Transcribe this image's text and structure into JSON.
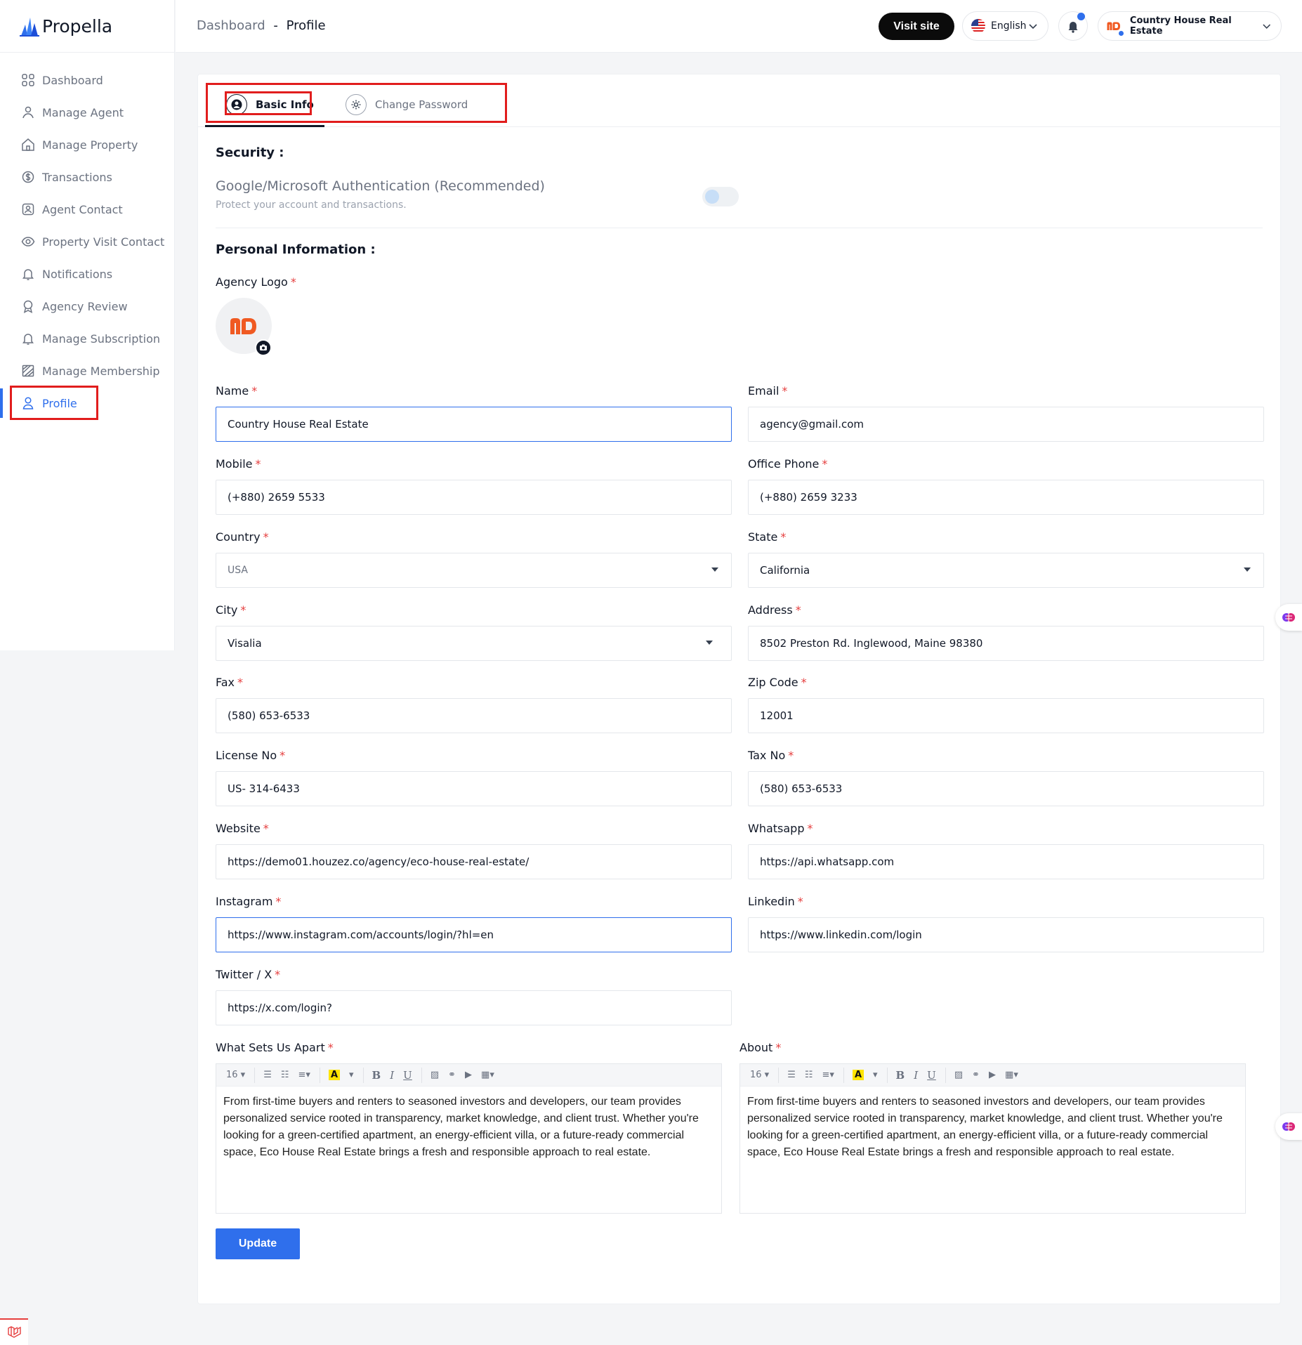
{
  "brand": {
    "name": "Propella"
  },
  "sidebar": {
    "items": [
      {
        "label": "Dashboard"
      },
      {
        "label": "Manage Agent"
      },
      {
        "label": "Manage Property"
      },
      {
        "label": "Transactions"
      },
      {
        "label": "Agent Contact"
      },
      {
        "label": "Property Visit Contact"
      },
      {
        "label": "Notifications"
      },
      {
        "label": "Agency Review"
      },
      {
        "label": "Manage Subscription"
      },
      {
        "label": "Manage Membership"
      },
      {
        "label": "Profile"
      }
    ],
    "active": "Profile"
  },
  "header": {
    "breadcrumb_root": "Dashboard",
    "breadcrumb_sep": "-",
    "breadcrumb_current": "Profile",
    "visit_site": "Visit site",
    "language": "English",
    "account_name": "Country House Real Estate"
  },
  "tabs": {
    "basic": "Basic Info",
    "password": "Change Password"
  },
  "security": {
    "title": "Security :",
    "auth_label": "Google/Microsoft Authentication (Recommended)",
    "auth_desc": "Protect your account and transactions.",
    "auth_enabled": false
  },
  "personal": {
    "title": "Personal Information :"
  },
  "form": {
    "logo_label": "Agency Logo",
    "name": {
      "label": "Name",
      "value": "Country House Real Estate"
    },
    "email": {
      "label": "Email",
      "value": "agency@gmail.com"
    },
    "mobile": {
      "label": "Mobile",
      "value": "(+880) 2659 5533"
    },
    "office_phone": {
      "label": "Office Phone",
      "value": "(+880) 2659 3233"
    },
    "country": {
      "label": "Country",
      "value": "USA"
    },
    "state": {
      "label": "State",
      "value": "California"
    },
    "city": {
      "label": "City",
      "value": "Visalia"
    },
    "address": {
      "label": "Address",
      "value": "8502 Preston Rd. Inglewood, Maine 98380"
    },
    "fax": {
      "label": "Fax",
      "value": "(580) 653-6533"
    },
    "zip": {
      "label": "Zip Code",
      "value": "12001"
    },
    "license": {
      "label": "License No",
      "value": "US- 314-6433"
    },
    "tax": {
      "label": "Tax No",
      "value": "(580) 653-6533"
    },
    "website": {
      "label": "Website",
      "value": "https://demo01.houzez.co/agency/eco-house-real-estate/"
    },
    "whatsapp": {
      "label": "Whatsapp",
      "value": "https://api.whatsapp.com"
    },
    "instagram": {
      "label": "Instagram",
      "value": "https://www.instagram.com/accounts/login/?hl=en"
    },
    "linkedin": {
      "label": "Linkedin",
      "value": "https://www.linkedin.com/login"
    },
    "twitter": {
      "label": "Twitter / X",
      "value": "https://x.com/login?"
    },
    "apart": {
      "label": "What Sets Us Apart",
      "value": "From first-time buyers and renters to seasoned investors and developers, our team provides personalized service rooted in transparency, market knowledge, and client trust. Whether you're looking for a green-certified apartment, an energy-efficient villa, or a future-ready commercial space, Eco House Real Estate brings a fresh and responsible approach to real estate."
    },
    "about": {
      "label": "About",
      "value": "From first-time buyers and renters to seasoned investors and developers, our team provides personalized service rooted in transparency, market knowledge, and client trust. Whether you're looking for a green-certified apartment, an energy-efficient villa, or a future-ready commercial space, Eco House Real Estate brings a fresh and responsible approach to real estate."
    },
    "required_mark": "*"
  },
  "editor": {
    "font_size": "16"
  },
  "actions": {
    "update": "Update"
  },
  "colors": {
    "accent": "#2f6fec",
    "highlight_box": "#e11d1d",
    "logo": "#f05a22"
  }
}
